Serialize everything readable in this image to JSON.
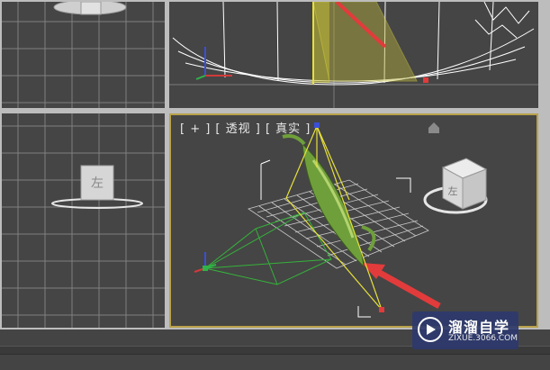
{
  "viewports": {
    "perspective": {
      "label": "[ + ] [ 透视 ] [ 真实 ]"
    }
  },
  "colors": {
    "viewport_bg": "#454545",
    "grid": "#7a7a7a",
    "active_border": "#b9a24a",
    "light_ray": "#e23b3b",
    "selection": "#e6e03a",
    "teapot": "#6f9f3b"
  },
  "view_cube": {
    "left_view_face": "左",
    "perspective_face": "左"
  },
  "watermark": {
    "title": "溜溜自学",
    "url": "ZIXUE.3066.COM"
  }
}
